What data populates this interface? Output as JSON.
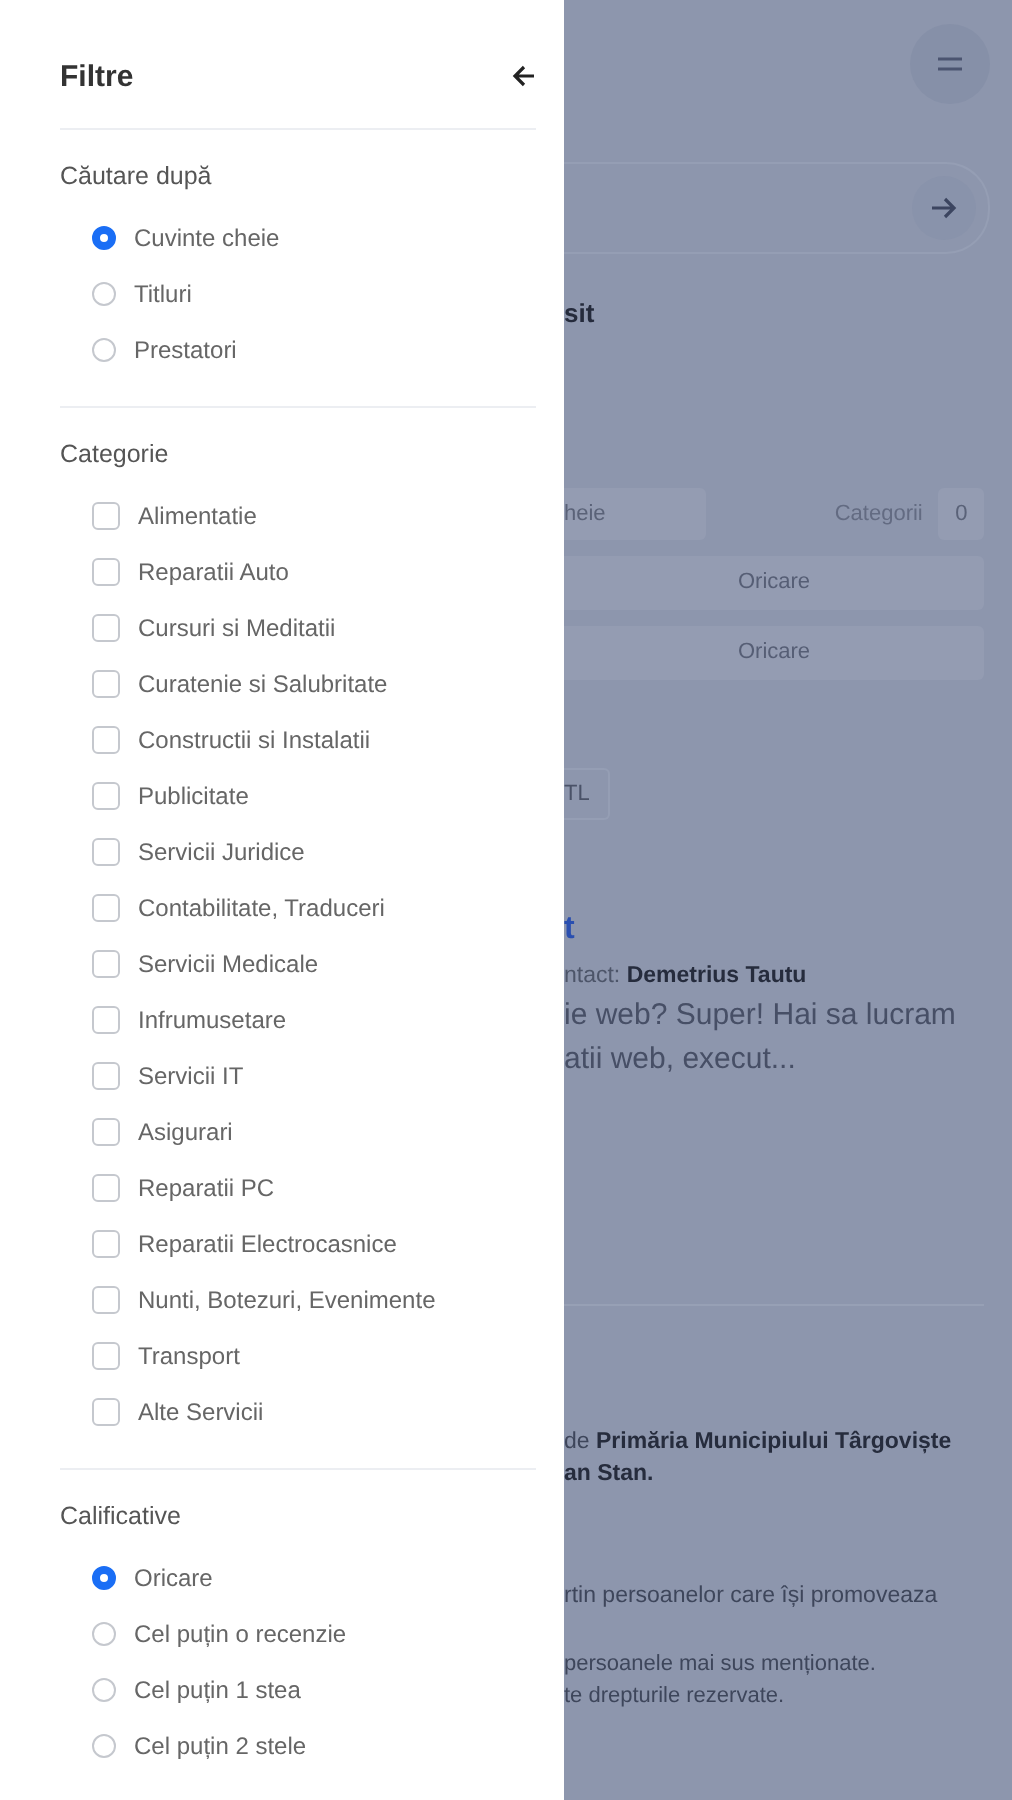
{
  "drawer": {
    "title": "Filtre",
    "sections": [
      {
        "title": "Căutare după",
        "kind": "radio",
        "options": [
          {
            "label": "Cuvinte cheie",
            "selected": true
          },
          {
            "label": "Titluri",
            "selected": false
          },
          {
            "label": "Prestatori",
            "selected": false
          }
        ]
      },
      {
        "title": "Categorie",
        "kind": "checkbox",
        "options": [
          {
            "label": "Alimentatie",
            "checked": false
          },
          {
            "label": "Reparatii Auto",
            "checked": false
          },
          {
            "label": "Cursuri si Meditatii",
            "checked": false
          },
          {
            "label": "Curatenie si Salubritate",
            "checked": false
          },
          {
            "label": "Constructii si Instalatii",
            "checked": false
          },
          {
            "label": "Publicitate",
            "checked": false
          },
          {
            "label": "Servicii Juridice",
            "checked": false
          },
          {
            "label": "Contabilitate, Traduceri",
            "checked": false
          },
          {
            "label": "Servicii Medicale",
            "checked": false
          },
          {
            "label": "Infrumusetare",
            "checked": false
          },
          {
            "label": "Servicii IT",
            "checked": false
          },
          {
            "label": "Asigurari",
            "checked": false
          },
          {
            "label": "Reparatii PC",
            "checked": false
          },
          {
            "label": "Reparatii Electrocasnice",
            "checked": false
          },
          {
            "label": "Nunti, Botezuri, Evenimente",
            "checked": false
          },
          {
            "label": "Transport",
            "checked": false
          },
          {
            "label": "Alte Servicii",
            "checked": false
          }
        ]
      },
      {
        "title": "Calificative",
        "kind": "radio",
        "options": [
          {
            "label": "Oricare",
            "selected": true
          },
          {
            "label": "Cel puțin o recenzie",
            "selected": false
          },
          {
            "label": "Cel puțin 1 stea",
            "selected": false
          },
          {
            "label": "Cel puțin 2 stele",
            "selected": false
          }
        ]
      }
    ]
  },
  "background": {
    "heading_fragment": "sit",
    "filter_row": {
      "field_value": "heie",
      "label": "Categorii",
      "count": "0"
    },
    "selects": [
      "Oricare",
      "Oricare"
    ],
    "chip": "TL",
    "result": {
      "title_fragment": "t",
      "contact_label": "ntact:",
      "contact_name": "Demetrius Tautu",
      "description_lines": [
        "ie web? Super! Hai sa lucram",
        "atii web, execut..."
      ]
    },
    "footer_lines": [
      "de **Primăria Municipiului Târgoviște**",
      "**an Stan.**",
      "rtin persoanelor care își promoveaza",
      "persoanele mai sus menționate.",
      "te drepturile rezervate."
    ]
  }
}
